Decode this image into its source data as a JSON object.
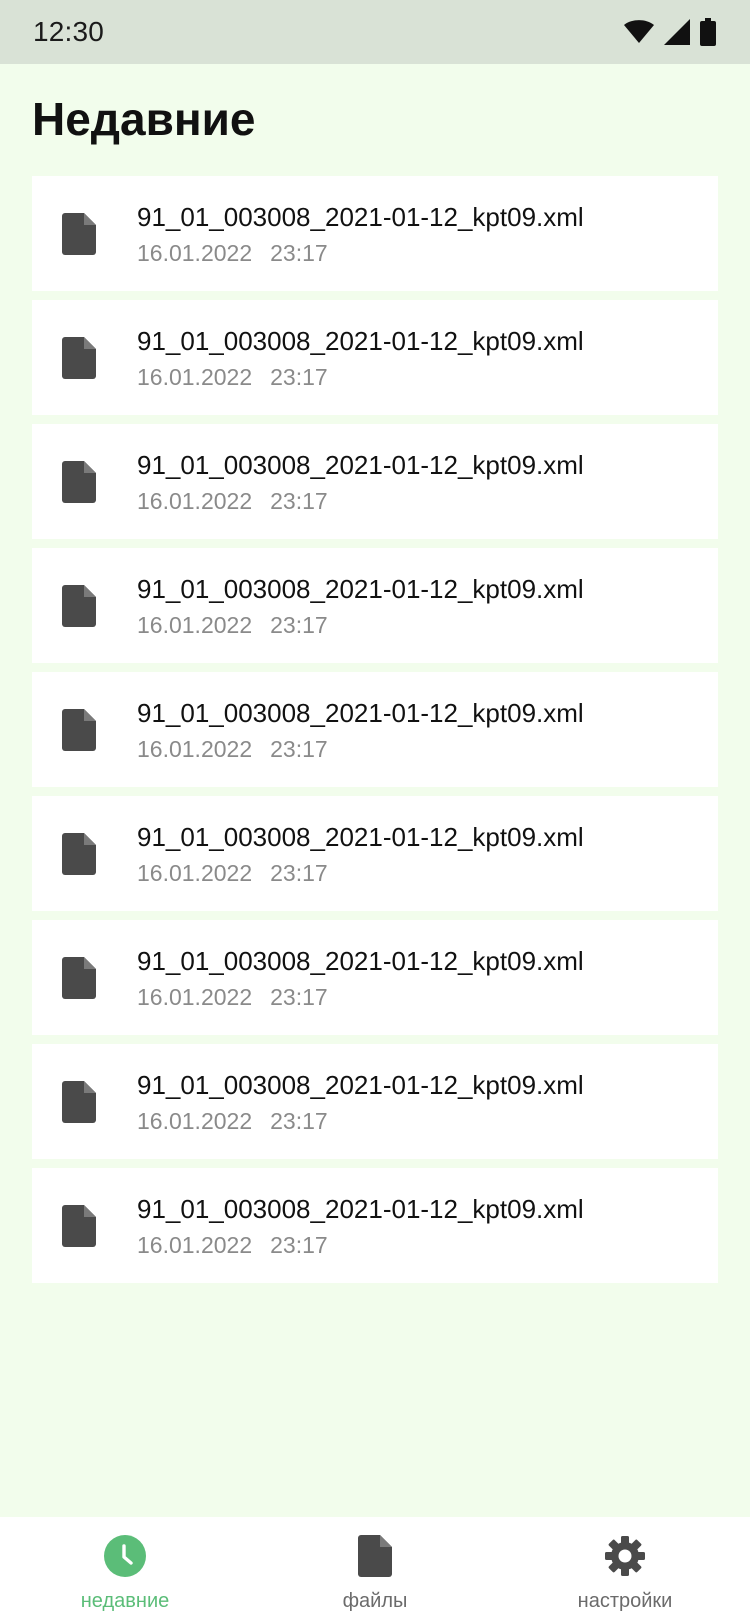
{
  "status_bar": {
    "time": "12:30",
    "icons": [
      "wifi-icon",
      "cell-signal-icon",
      "battery-icon"
    ]
  },
  "page": {
    "title": "Недавние"
  },
  "files": [
    {
      "name": "91_01_003008_2021-01-12_kpt09.xml",
      "date": "16.01.2022",
      "time": "23:17"
    },
    {
      "name": "91_01_003008_2021-01-12_kpt09.xml",
      "date": "16.01.2022",
      "time": "23:17"
    },
    {
      "name": "91_01_003008_2021-01-12_kpt09.xml",
      "date": "16.01.2022",
      "time": "23:17"
    },
    {
      "name": "91_01_003008_2021-01-12_kpt09.xml",
      "date": "16.01.2022",
      "time": "23:17"
    },
    {
      "name": "91_01_003008_2021-01-12_kpt09.xml",
      "date": "16.01.2022",
      "time": "23:17"
    },
    {
      "name": "91_01_003008_2021-01-12_kpt09.xml",
      "date": "16.01.2022",
      "time": "23:17"
    },
    {
      "name": "91_01_003008_2021-01-12_kpt09.xml",
      "date": "16.01.2022",
      "time": "23:17"
    },
    {
      "name": "91_01_003008_2021-01-12_kpt09.xml",
      "date": "16.01.2022",
      "time": "23:17"
    },
    {
      "name": "91_01_003008_2021-01-12_kpt09.xml",
      "date": "16.01.2022",
      "time": "23:17"
    }
  ],
  "file_icon": "document-icon",
  "bottom_nav": {
    "items": [
      {
        "label": "недавние",
        "icon": "clock-icon",
        "active": true
      },
      {
        "label": "файлы",
        "icon": "document-icon",
        "active": false
      },
      {
        "label": "настройки",
        "icon": "gear-icon",
        "active": false
      }
    ]
  },
  "colors": {
    "background": "#f2fdec",
    "status_bar": "#d9e2d6",
    "accent": "#5bbd78",
    "icon_dark": "#4a4a4a",
    "meta_text": "#8a8a8a"
  }
}
